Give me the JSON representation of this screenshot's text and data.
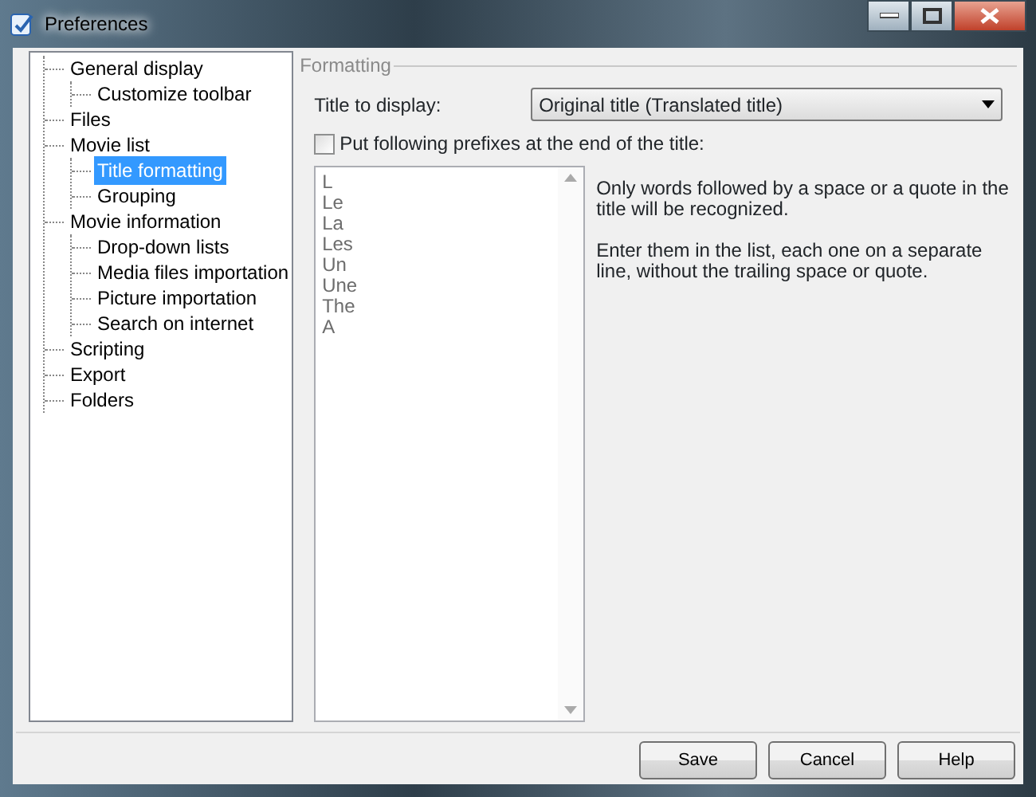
{
  "window": {
    "title": "Preferences"
  },
  "tree": [
    {
      "label": "General display",
      "selected": false,
      "children": [
        {
          "label": "Customize toolbar",
          "selected": false
        }
      ]
    },
    {
      "label": "Files",
      "selected": false
    },
    {
      "label": "Movie list",
      "selected": false,
      "children": [
        {
          "label": "Title formatting",
          "selected": true
        },
        {
          "label": "Grouping",
          "selected": false
        }
      ]
    },
    {
      "label": "Movie information",
      "selected": false,
      "children": [
        {
          "label": "Drop-down lists",
          "selected": false
        },
        {
          "label": "Media files importation",
          "selected": false
        },
        {
          "label": "Picture importation",
          "selected": false
        },
        {
          "label": "Search on internet",
          "selected": false
        }
      ]
    },
    {
      "label": "Scripting",
      "selected": false
    },
    {
      "label": "Export",
      "selected": false
    },
    {
      "label": "Folders",
      "selected": false
    }
  ],
  "group": {
    "title": "Formatting",
    "title_to_display": {
      "label": "Title to display:",
      "value": "Original title (Translated title)"
    },
    "prefix_checkbox": {
      "label": "Put following prefixes at the end of the title:",
      "checked": false
    },
    "prefix_list": {
      "disabled": true,
      "items": [
        "L",
        "Le",
        "La",
        "Les",
        "Un",
        "Une",
        "The",
        "A"
      ]
    },
    "help": [
      "Only words followed by a space or a quote in the title will be recognized.",
      "Enter them in the list, each one on a separate line, without the trailing space or quote."
    ]
  },
  "buttons": [
    "Save",
    "Cancel",
    "Help"
  ]
}
